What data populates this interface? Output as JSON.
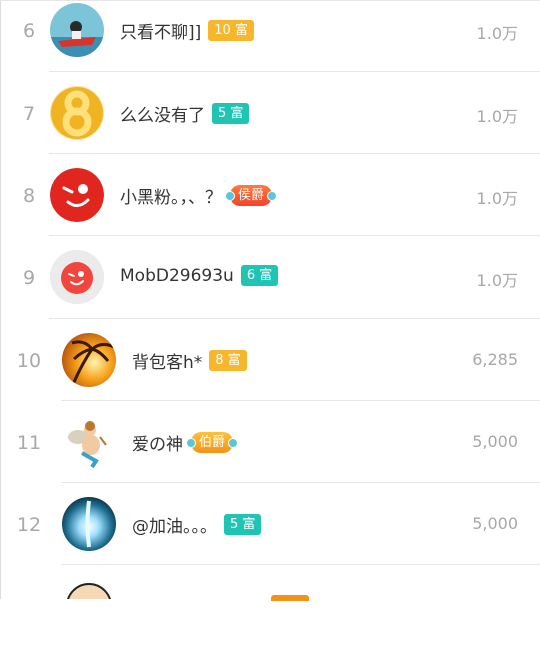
{
  "ranking": [
    {
      "rank": "6",
      "name": "只看不聊]]",
      "badge": "10 富",
      "badge_type": "wealth-orange",
      "value": "1.0万"
    },
    {
      "rank": "7",
      "name": "么么没有了",
      "badge": "5 富",
      "badge_type": "wealth-teal",
      "value": "1.0万"
    },
    {
      "rank": "8",
      "name": "小黑粉。，、？",
      "badge": "侯爵",
      "badge_type": "noble-red",
      "value": "1.0万"
    },
    {
      "rank": "9",
      "name": "MobD29693u",
      "badge": "6 富",
      "badge_type": "wealth-teal",
      "value": "1.0万"
    },
    {
      "rank": "10",
      "name": "背包客h*",
      "badge": "8 富",
      "badge_type": "wealth-orange",
      "value": "6,285"
    },
    {
      "rank": "11",
      "name": "爱の神",
      "badge": "伯爵",
      "badge_type": "noble-amber",
      "value": "5,000"
    },
    {
      "rank": "12",
      "name": "@加油。。。",
      "badge": "5 富",
      "badge_type": "wealth-teal",
      "value": "5,000"
    }
  ],
  "colors": {
    "wealth_orange": "#f8b62c",
    "wealth_teal": "#1fc4b3",
    "noble_red": "#f2432e",
    "text_primary": "#333333",
    "text_secondary": "#a8a8a8"
  },
  "avatars": [
    "jetski-avatar",
    "golden-eight-avatar",
    "red-wink-face-avatar",
    "red-wink-face-avatar",
    "palm-sunset-avatar",
    "cupid-angel-avatar",
    "blue-light-avatar",
    "bald-cartoon-avatar"
  ]
}
